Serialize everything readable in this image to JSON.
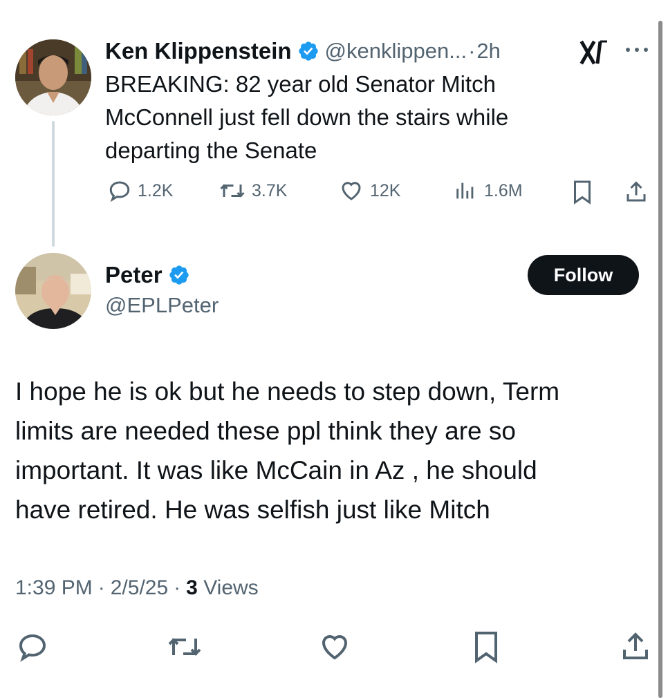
{
  "quoted_tweet": {
    "author_name": "Ken Klippenstein",
    "handle": "@kenklippen...",
    "separator": "·",
    "time": "2h",
    "text_lines": [
      "BREAKING: 82 year old Senator Mitch",
      "McConnell just fell down the stairs while",
      "departing the Senate"
    ],
    "replies": "1.2K",
    "retweets": "3.7K",
    "likes": "12K",
    "views": "1.6M"
  },
  "reply": {
    "author_name": "Peter",
    "handle": "@EPLPeter",
    "follow_label": "Follow",
    "text_lines": [
      "I hope he is ok but he needs to step down, Term",
      "limits are needed these ppl think they are so",
      "important. It was like McCain in Az , he should",
      "have retired. He was selfish just like Mitch"
    ],
    "time": "1:39 PM",
    "date": "2/5/25",
    "sep": "·",
    "views_count": "3",
    "views_label": "Views"
  },
  "colors": {
    "verified_blue": "#1d9bf0",
    "text_primary": "#0f1419",
    "text_secondary": "#536471"
  },
  "icons": [
    "verified-icon",
    "grok-icon",
    "more-icon",
    "reply-icon",
    "retweet-icon",
    "like-icon",
    "views-icon",
    "bookmark-icon",
    "share-icon"
  ]
}
